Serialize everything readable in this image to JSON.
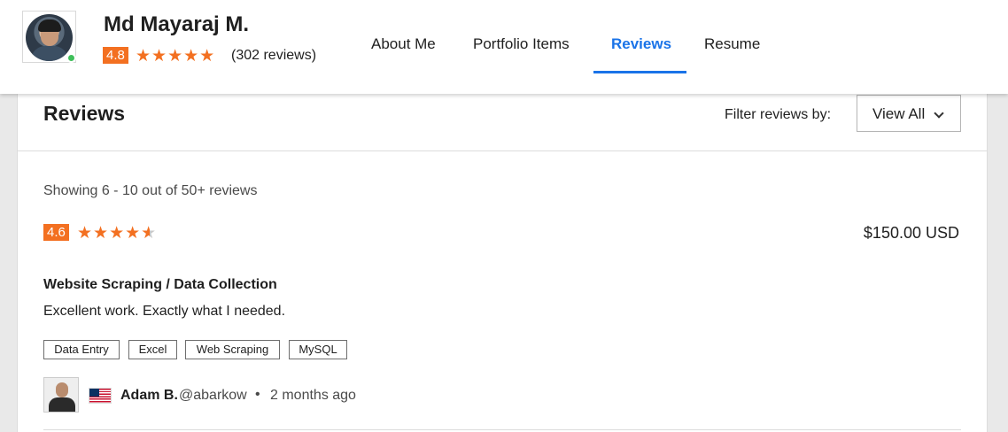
{
  "profile": {
    "name": "Md Mayaraj M.",
    "rating": "4.8",
    "stars": "★★★★★",
    "review_count": "(302 reviews)"
  },
  "nav": {
    "items": [
      {
        "label": "About Me"
      },
      {
        "label": "Portfolio Items"
      },
      {
        "label": "Reviews"
      },
      {
        "label": "Resume"
      }
    ],
    "active": "Reviews"
  },
  "reviews_section": {
    "title": "Reviews",
    "filter_label": "Filter reviews by:",
    "filter_value": "View All",
    "showing_text": "Showing 6 - 10 out of 50+ reviews"
  },
  "review": {
    "rating": "4.6",
    "rating_value": 4.6,
    "stars": "★★★★★",
    "price": "$150.00 USD",
    "project_title": "Website Scraping / Data Collection",
    "text": "Excellent work. Exactly what I needed.",
    "tags": [
      "Data Entry",
      "Excel",
      "Web Scraping",
      "MySQL"
    ],
    "reviewer_name": "Adam B.",
    "reviewer_handle": "@abarkow",
    "separator": "•",
    "time": "2 months ago"
  },
  "colors": {
    "accent": "#1a73e8",
    "rating_orange": "#f37021",
    "online": "#3fbf5a"
  }
}
